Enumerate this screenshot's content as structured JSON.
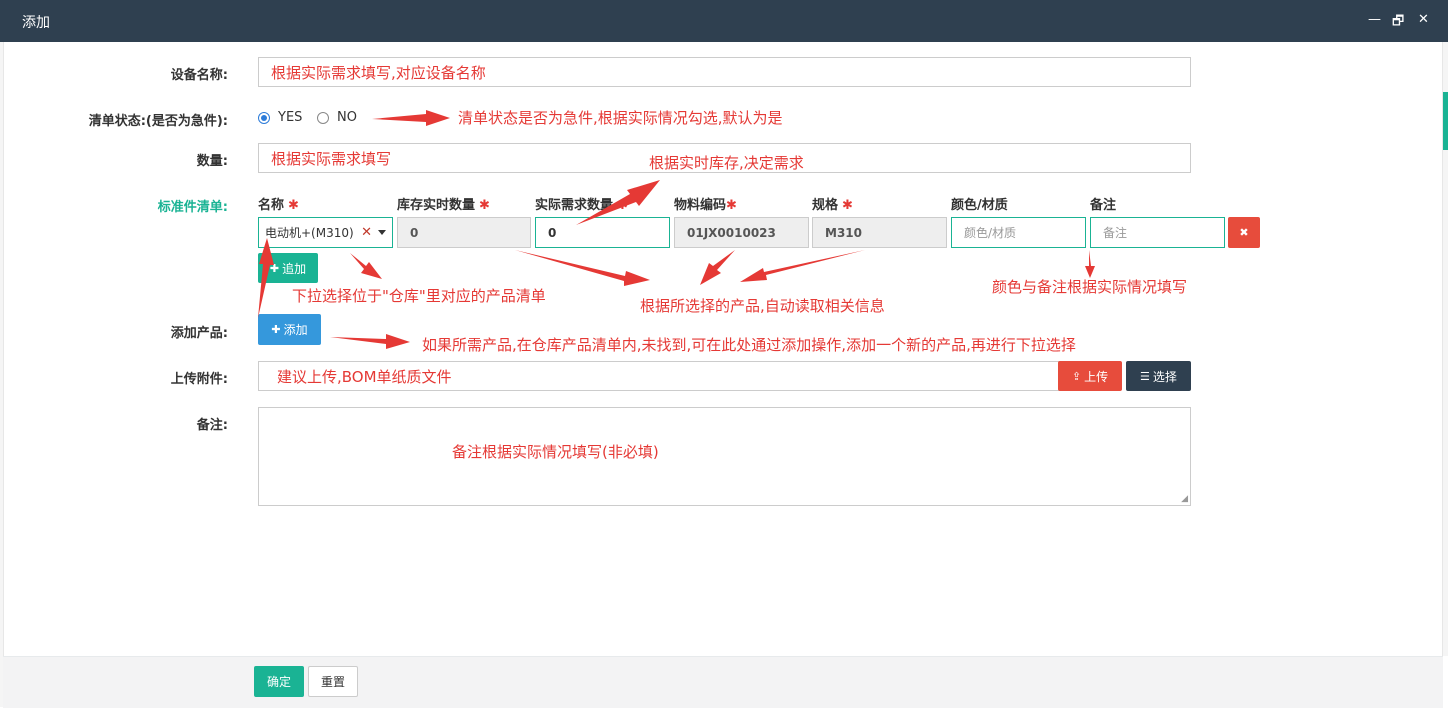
{
  "window": {
    "title": "添加",
    "minimize": "—",
    "maximize": "🗗",
    "close": "✕"
  },
  "form": {
    "device_name": {
      "label": "设备名称:",
      "value": "根据实际需求填写,对应设备名称"
    },
    "list_status": {
      "label": "清单状态:(是否为急件):",
      "options": [
        {
          "label": "YES",
          "checked": true
        },
        {
          "label": "NO",
          "checked": false
        }
      ]
    },
    "quantity": {
      "label": "数量:",
      "value": "根据实际需求填写"
    },
    "standard_list": {
      "label": "标准件清单:",
      "columns": [
        "名称",
        "库存实时数量",
        "实际需求数量",
        "物料编码",
        "规格",
        "颜色/材质",
        "备注"
      ],
      "required_mark": "✱",
      "row": {
        "name": "电动机+(M310)",
        "clear_icon": "✕",
        "stock": "0",
        "demand": "0",
        "code": "01JX0010023",
        "spec": "M310",
        "color_placeholder": "颜色/材质",
        "remark_placeholder": "备注",
        "delete_icon": "✖"
      },
      "append_button": "追加",
      "append_icon": "✚"
    },
    "add_product": {
      "label": "添加产品:",
      "button": "添加",
      "icon": "✚"
    },
    "upload": {
      "label": "上传附件:",
      "value": "建议上传,BOM单纸质文件",
      "upload_button": "上传",
      "upload_icon": "⇪",
      "select_button": "选择",
      "select_icon": "☰"
    },
    "remark": {
      "label": "备注:",
      "value": "备注根据实际情况填写(非必填)"
    }
  },
  "annotations": {
    "status": "清单状态是否为急件,根据实际情况勾选,默认为是",
    "stock": "根据实时库存,决定需求",
    "dropdown": "下拉选择位于\"仓库\"里对应的产品清单",
    "auto": "根据所选择的产品,自动读取相关信息",
    "color": "颜色与备注根据实际情况填写",
    "add": "如果所需产品,在仓库产品清单内,未找到,可在此处通过添加操作,添加一个新的产品,再进行下拉选择"
  },
  "footer": {
    "confirm": "确定",
    "reset": "重置"
  },
  "colors": {
    "accent": "#1ab394",
    "titlebar": "#2f4050",
    "annotation": "#e53935"
  }
}
